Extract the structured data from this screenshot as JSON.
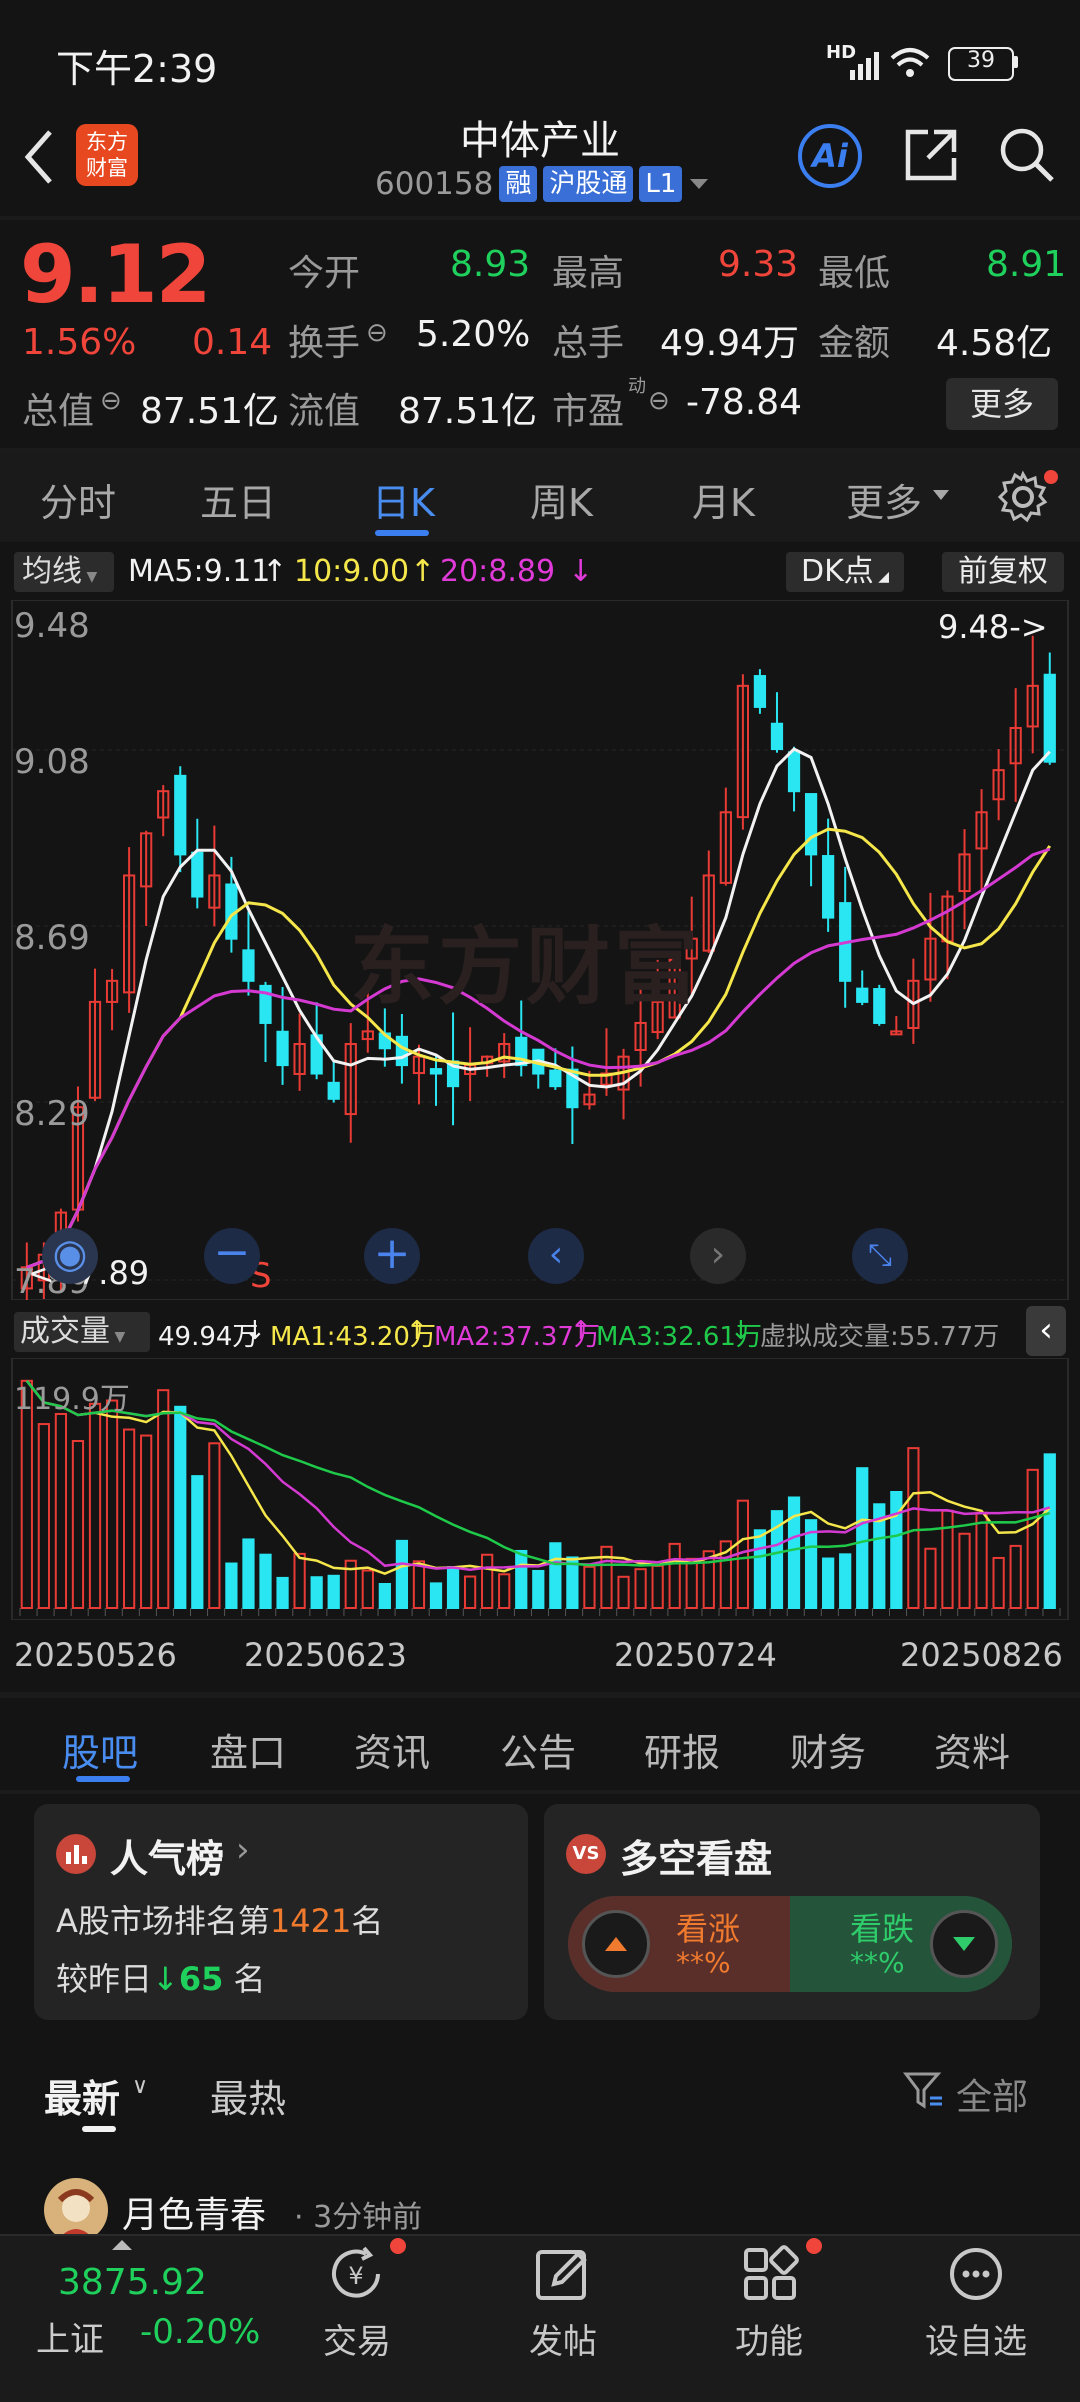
{
  "status_bar": {
    "time": "下午2:39",
    "battery": "39",
    "network": "HD"
  },
  "header": {
    "title": "中体产业",
    "code": "600158",
    "tags": [
      "融",
      "沪股通",
      "L1"
    ],
    "logo_text": [
      "东方",
      "财富"
    ],
    "ai_label": "Ai"
  },
  "quote": {
    "price": "9.12",
    "change_pct": "1.56%",
    "change": "0.14",
    "fields": {
      "open_label": "今开",
      "open": "8.93",
      "high_label": "最高",
      "high": "9.33",
      "low_label": "最低",
      "low": "8.91",
      "turnover_label": "换手",
      "turnover": "5.20%",
      "volume_label": "总手",
      "volume": "49.94万",
      "amount_label": "金额",
      "amount": "4.58亿",
      "mktcap_label": "总值",
      "mktcap": "87.51亿",
      "float_label": "流值",
      "float": "87.51亿",
      "pe_label": "市盈",
      "pe_sup": "动",
      "pe": "-78.84"
    },
    "more_button": "更多"
  },
  "ktabs": [
    "分时",
    "五日",
    "日K",
    "周K",
    "月K",
    "更多"
  ],
  "ktab_active": 2,
  "ma_bar": {
    "selector": "均线",
    "ma5": "MA5:9.11",
    "ma10": "10:9.00",
    "ma20": "20:8.89",
    "dk": "DK点",
    "fq": "前复权"
  },
  "chart_axis": {
    "y_labels": [
      "9.48",
      "9.08",
      "8.69",
      "8.29",
      "7.89"
    ],
    "max_marker": "9.48->",
    "min_marker": "<--7.89",
    "watermark": "东方财富",
    "s_marker": "S"
  },
  "volume_bar": {
    "selector": "成交量",
    "vol": "49.94万",
    "ma1": "MA1:43.20万",
    "ma2": "MA2:37.37万",
    "ma3": "MA3:32.61万",
    "virtual": "虚拟成交量:55.77万",
    "max_label": "119.9万"
  },
  "x_dates": [
    "20250526",
    "20250623",
    "20250724",
    "20250826"
  ],
  "chart_data": {
    "type": "candlestick",
    "price_ylim": [
      7.89,
      9.48
    ],
    "volume_ylim_label": "119.9万",
    "last": {
      "close": 9.12,
      "ma5": 9.11,
      "ma10": 9.0,
      "ma20": 8.89,
      "volume": "49.94万"
    }
  },
  "section_tabs": [
    "股吧",
    "盘口",
    "资讯",
    "公告",
    "研报",
    "财务",
    "资料"
  ],
  "section_active": 0,
  "popularity": {
    "title": "人气榜",
    "rank_prefix": "A股市场排名第",
    "rank": "1421",
    "rank_suffix": "名",
    "change_prefix": "较昨日",
    "change": "65",
    "change_suffix": "名"
  },
  "sentiment": {
    "title": "多空看盘",
    "bull_label": "看涨",
    "bull_value": "**%",
    "bear_label": "看跌",
    "bear_value": "**%",
    "vs_badge": "VS"
  },
  "feed_tabs": {
    "latest": "最新",
    "hot": "最热",
    "filter": "全部"
  },
  "post": {
    "user": "月色青春",
    "time": "· 3分钟前"
  },
  "bottom_bar": {
    "index_value": "3875.92",
    "index_name": "上证",
    "index_change": "-0.20%",
    "items": [
      "交易",
      "发帖",
      "功能",
      "设自选"
    ]
  }
}
